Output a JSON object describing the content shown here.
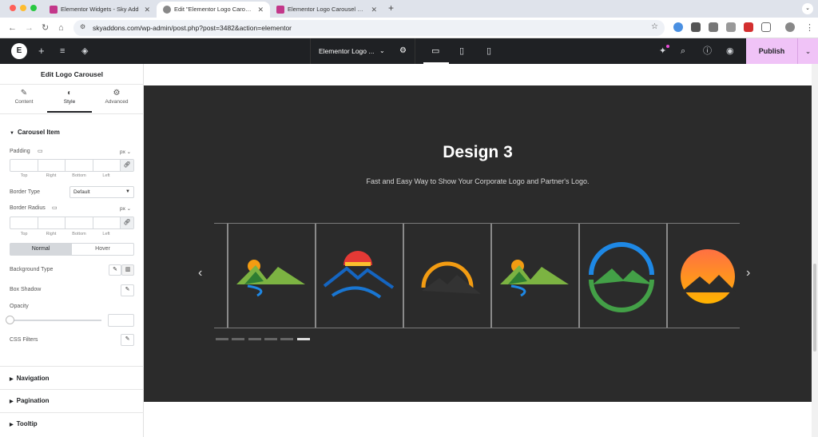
{
  "browser": {
    "tabs": [
      {
        "title": "Elementor Widgets - Sky Add"
      },
      {
        "title": "Edit \"Elementor Logo Carousel"
      },
      {
        "title": "Elementor Logo Carousel Wid"
      }
    ],
    "new_tab": "+",
    "url": "skyaddons.com/wp-admin/post.php?post=3482&action=elementor"
  },
  "editor": {
    "document_name": "Elementor Logo ...",
    "publish_label": "Publish"
  },
  "panel": {
    "title": "Edit Logo Carousel",
    "tabs": [
      {
        "label": "Content",
        "icon": "pencil-icon"
      },
      {
        "label": "Style",
        "icon": "contrast-icon"
      },
      {
        "label": "Advanced",
        "icon": "gear-icon"
      }
    ],
    "section_carousel_item": "Carousel Item",
    "padding_label": "Padding",
    "padding_unit": "px",
    "box_sublabels": [
      "Top",
      "Right",
      "Bottom",
      "Left"
    ],
    "border_type_label": "Border Type",
    "border_type_value": "Default",
    "border_radius_label": "Border Radius",
    "border_radius_unit": "px",
    "state_normal": "Normal",
    "state_hover": "Hover",
    "background_type_label": "Background Type",
    "box_shadow_label": "Box Shadow",
    "opacity_label": "Opacity",
    "css_filters_label": "CSS Filters",
    "sections": [
      "Navigation",
      "Pagination",
      "Tooltip"
    ]
  },
  "preview": {
    "heading": "Design 3",
    "subheading": "Fast and Easy Way to Show Your Corporate Logo and Partner's Logo.",
    "pagination_count": 6,
    "active_page": 6
  },
  "colors": {
    "elementor_dark": "#1f2124",
    "publish_bg": "#f0c3f7",
    "stage_bg": "#2b2b2b"
  }
}
